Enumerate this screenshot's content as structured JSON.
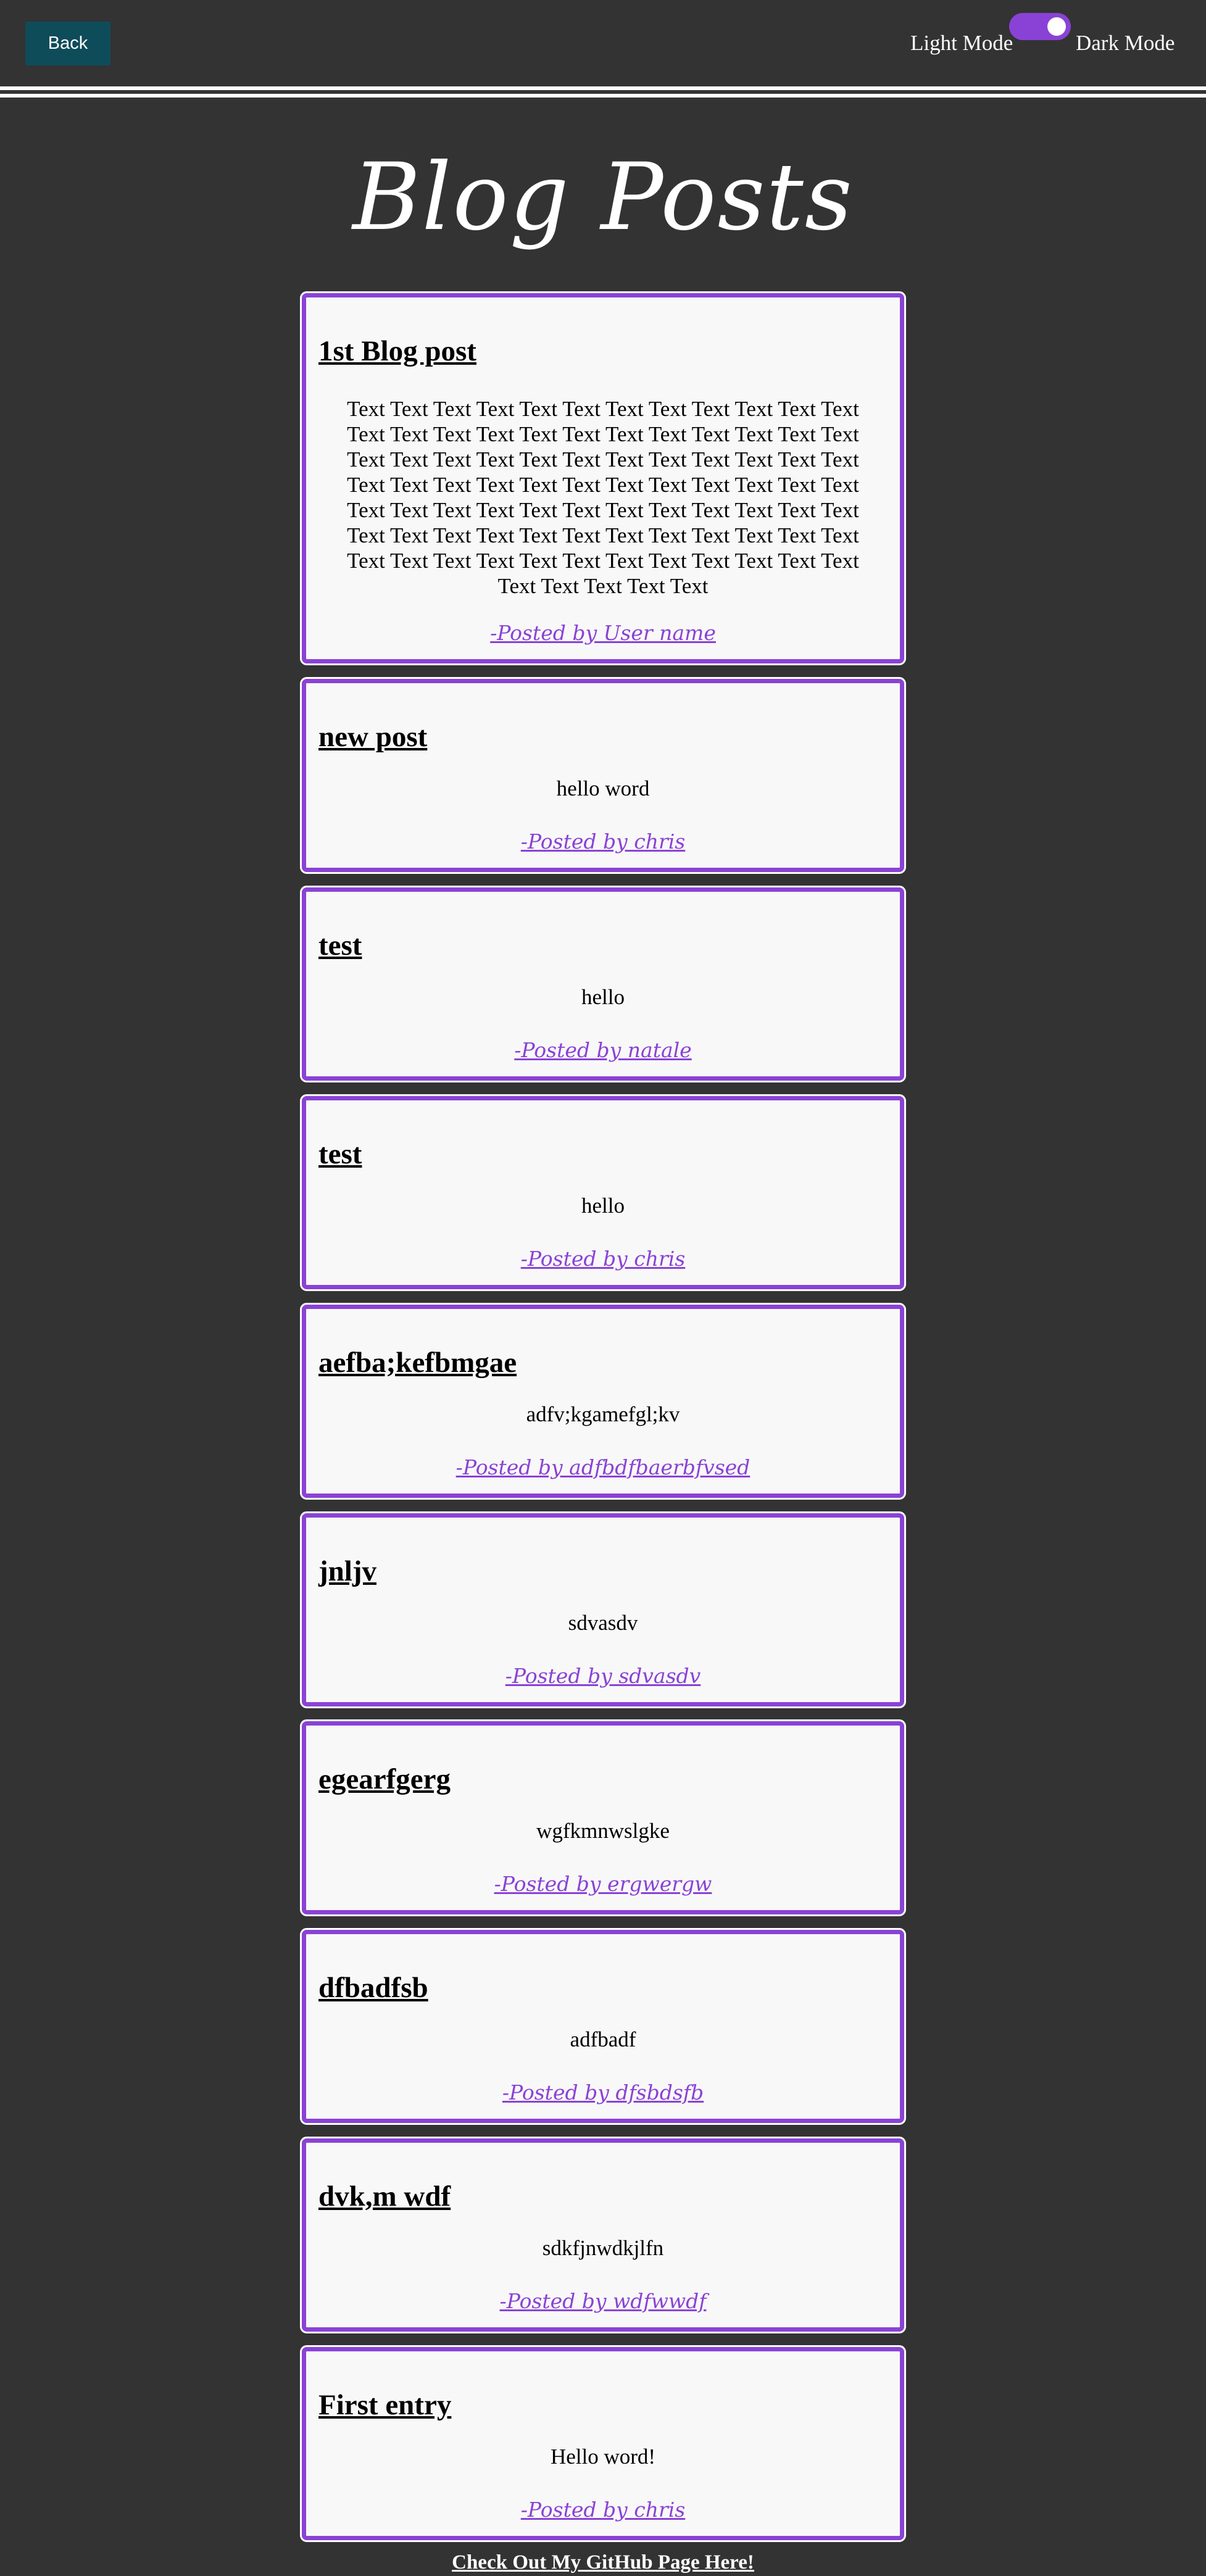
{
  "header": {
    "back_label": "Back",
    "light_mode_label": "Light Mode",
    "dark_mode_label": "Dark Mode",
    "toggle_state": "dark"
  },
  "colors": {
    "background": "#333333",
    "accent": "#8a42d6",
    "back_button": "#0e4c5a",
    "card": "#f8f8f8"
  },
  "page": {
    "title": "Blog Posts"
  },
  "posts": [
    {
      "title": "1st Blog post",
      "body": "Text Text Text Text Text Text Text Text Text Text Text Text Text Text Text Text Text Text Text Text Text Text Text Text Text Text Text Text Text Text Text Text Text Text Text Text Text Text Text Text Text Text Text Text Text Text Text Text Text Text Text Text Text Text Text Text Text Text Text Text Text Text Text Text Text Text Text Text Text Text Text Text Text Text Text Text Text Text Text Text Text Text Text Text Text Text Text Text Text",
      "author": "-Posted by User name"
    },
    {
      "title": "new post",
      "body": "hello word",
      "author": "-Posted by chris"
    },
    {
      "title": "test",
      "body": "hello",
      "author": "-Posted by natale"
    },
    {
      "title": "test",
      "body": "hello",
      "author": "-Posted by chris"
    },
    {
      "title": "aefba;kefbmgae",
      "body": "adfv;kgamefgl;kv",
      "author": "-Posted by adfbdfbaerbfvsed"
    },
    {
      "title": "jnljv",
      "body": "sdvasdv",
      "author": "-Posted by sdvasdv"
    },
    {
      "title": "egearfgerg",
      "body": "wgfkmnwslgke",
      "author": "-Posted by ergwergw"
    },
    {
      "title": "dfbadfsb",
      "body": "adfbadf",
      "author": "-Posted by dfsbdsfb"
    },
    {
      "title": "dvk,m wdf",
      "body": "sdkfjnwdkjlfn",
      "author": "-Posted by wdfwwdf"
    },
    {
      "title": "First entry",
      "body": "Hello word!",
      "author": "-Posted by chris"
    }
  ],
  "footer": {
    "link_label": "Check Out My GitHub Page Here!"
  }
}
